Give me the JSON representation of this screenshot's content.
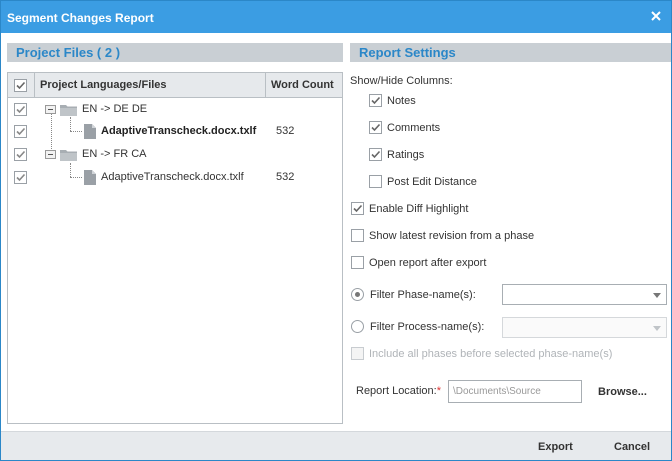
{
  "window": {
    "title": "Segment Changes Report",
    "close_icon": "close-icon"
  },
  "colors": {
    "titlebar": "#3b9de3",
    "accent": "#2b87c8",
    "panel_header_bg": "#c9cfd4",
    "footer_bg": "#e7eaed"
  },
  "project_files": {
    "header": "Project Files ( 2 )",
    "columns": {
      "name": "Project Languages/Files",
      "count": "Word Count"
    },
    "header_checked": true,
    "rows": [
      {
        "type": "language",
        "label": "EN -> DE DE",
        "checked": true
      },
      {
        "type": "file",
        "label": "AdaptiveTranscheck.docx.txlf",
        "count": "532",
        "checked": true,
        "bold": true
      },
      {
        "type": "language",
        "label": "EN -> FR CA",
        "checked": true
      },
      {
        "type": "file",
        "label": "AdaptiveTranscheck.docx.txlf",
        "count": "532",
        "checked": true,
        "bold": false
      }
    ]
  },
  "report_settings": {
    "header": "Report Settings",
    "show_hide_label": "Show/Hide Columns:",
    "columns": [
      {
        "label": "Notes",
        "checked": true
      },
      {
        "label": "Comments",
        "checked": true
      },
      {
        "label": "Ratings",
        "checked": true
      },
      {
        "label": "Post Edit Distance",
        "checked": false
      }
    ],
    "options": [
      {
        "label": "Enable Diff Highlight",
        "checked": true
      },
      {
        "label": "Show latest revision from a phase",
        "checked": false
      },
      {
        "label": "Open report after export",
        "checked": false
      }
    ],
    "filter_phase": {
      "label": "Filter Phase-name(s):",
      "selected": true,
      "value": ""
    },
    "filter_process": {
      "label": "Filter Process-name(s):",
      "selected": false,
      "value": ""
    },
    "include_all": {
      "label": "Include all phases before selected phase-name(s)",
      "checked": false
    },
    "report_location": {
      "label": "Report Location:",
      "required_mark": "*",
      "value": "\\Documents\\Source"
    },
    "browse_label": "Browse..."
  },
  "footer": {
    "export_label": "Export",
    "cancel_label": "Cancel"
  }
}
